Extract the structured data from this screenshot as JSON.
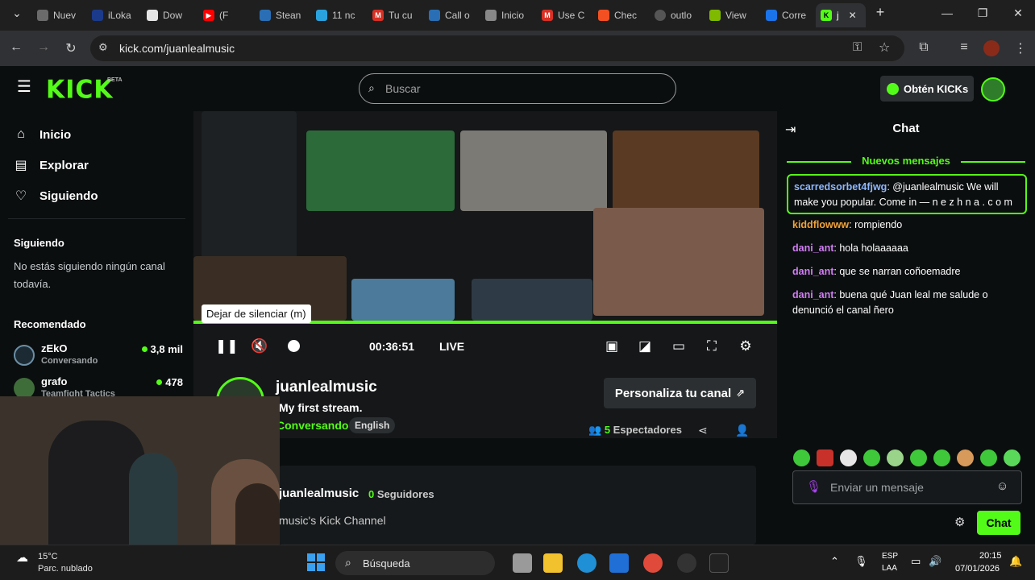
{
  "browser": {
    "tabs": [
      "Nuev",
      "iLoka",
      "Dow",
      "(F",
      "Stean",
      "11 nc",
      "Tu cu",
      "Call o",
      "Inicio",
      "Use C",
      "Chec",
      "outlo",
      "View",
      "Corre",
      "j"
    ],
    "url": "kick.com/juanlealmusic"
  },
  "header": {
    "logo": "KICK",
    "beta": "BETA",
    "search_placeholder": "Buscar",
    "kicks_button": "Obtén KICKs"
  },
  "sidebar": {
    "nav": [
      {
        "label": "Inicio",
        "icon": "home-icon"
      },
      {
        "label": "Explorar",
        "icon": "browse-icon"
      },
      {
        "label": "Siguiendo",
        "icon": "heart-icon"
      }
    ],
    "following_heading": "Siguiendo",
    "following_empty": "No estás siguiendo ningún canal todavía.",
    "recommended_heading": "Recomendado",
    "recommended": [
      {
        "name": "zEkO",
        "category": "Conversando",
        "viewers": "3,8 mil"
      },
      {
        "name": "grafo",
        "category": "Teamfight Tactics",
        "viewers": "478"
      }
    ]
  },
  "player": {
    "tooltip": "Dejar de silenciar (m)",
    "time": "00:36:51",
    "live_label": "LIVE",
    "progress": 1.0
  },
  "channel": {
    "name": "juanlealmusic",
    "stream_title": "My first stream.",
    "category": "Conversando",
    "language": "English",
    "customize_button": "Personaliza tu canal",
    "viewers_count": "5",
    "viewers_label": "Espectadores",
    "about_name": "juanlealmusic",
    "followers_count": "0",
    "followers_label": "Seguidores",
    "about_text": "music's Kick Channel"
  },
  "chat": {
    "title": "Chat",
    "new_messages": "Nuevos mensajes",
    "pinned": {
      "user": "scarredsorbet4fjwg",
      "text": "@juanlealmusic We will make you popular. Come in — n e z h n a . c o m"
    },
    "messages": [
      {
        "user": "kiddflowww",
        "text": "rompiendo",
        "color": "#f0a23a"
      },
      {
        "user": "dani_ant",
        "text": "hola holaaaaaa",
        "color": "#d17ef5"
      },
      {
        "user": "dani_ant",
        "text": "que se narran coñoemadre",
        "color": "#d17ef5"
      },
      {
        "user": "dani_ant",
        "text": "buena qué Juan leal me salude o denunció el canal ñero",
        "color": "#d17ef5"
      }
    ],
    "input_placeholder": "Enviar un mensaje",
    "send_button": "Chat"
  },
  "taskbar": {
    "weather_temp": "15°C",
    "weather_desc": "Parc. nublado",
    "search": "Búsqueda",
    "lang1": "ESP",
    "lang2": "LAA",
    "time": "20:15",
    "date": "07/01/2026"
  },
  "colors": {
    "accent": "#53fc18",
    "bg": "#0b0e0f"
  }
}
